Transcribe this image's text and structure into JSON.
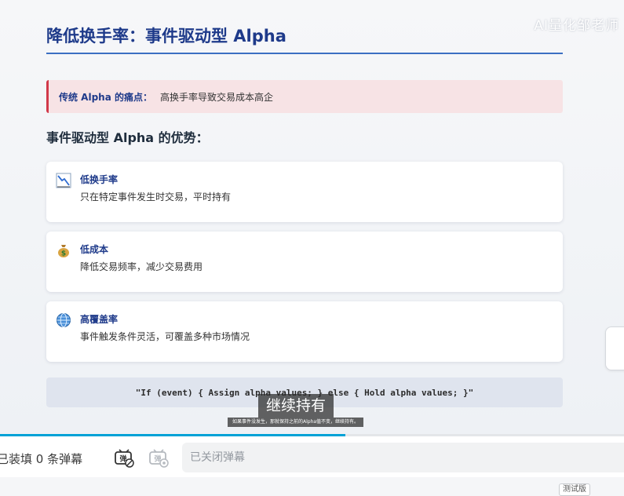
{
  "watermark": "AI量化邹老师",
  "slide": {
    "title": "降低换手率：事件驱动型 Alpha",
    "pain_label": "传统 Alpha 的痛点：",
    "pain_text": "高换手率导致交易成本高企",
    "advantages_heading": "事件驱动型 Alpha 的优势：",
    "cards": [
      {
        "icon": "chart-decreasing-icon",
        "title": "低换手率",
        "desc": "只在特定事件发生时交易，平时持有"
      },
      {
        "icon": "money-bag-icon",
        "title": "低成本",
        "desc": "降低交易频率，减少交易费用"
      },
      {
        "icon": "globe-icon",
        "title": "高覆盖率",
        "desc": "事件触发条件灵活，可覆盖多种市场情况"
      }
    ],
    "code": "\"If (event) { Assign alpha values; } else { Hold alpha values; }\""
  },
  "subtitles": {
    "main": "继续持有",
    "secondary": "如果事件没发生，那就保持之前的Alpha值不变，继续持有。"
  },
  "player": {
    "progress_fraction": 0.553,
    "progress_color": "#00a1d6",
    "danmaku_count": "已装填 0 条弹幕",
    "danmaku_toggle_icon": "danmaku-toggle-icon",
    "danmaku_settings_icon": "danmaku-settings-icon",
    "danmaku_input_placeholder": "已关闭弹幕",
    "beta_badge": "测试版"
  },
  "colors": {
    "title": "#1e3a8a",
    "pain_accent": "#d1394a",
    "pain_bg": "#f7e3e5"
  }
}
